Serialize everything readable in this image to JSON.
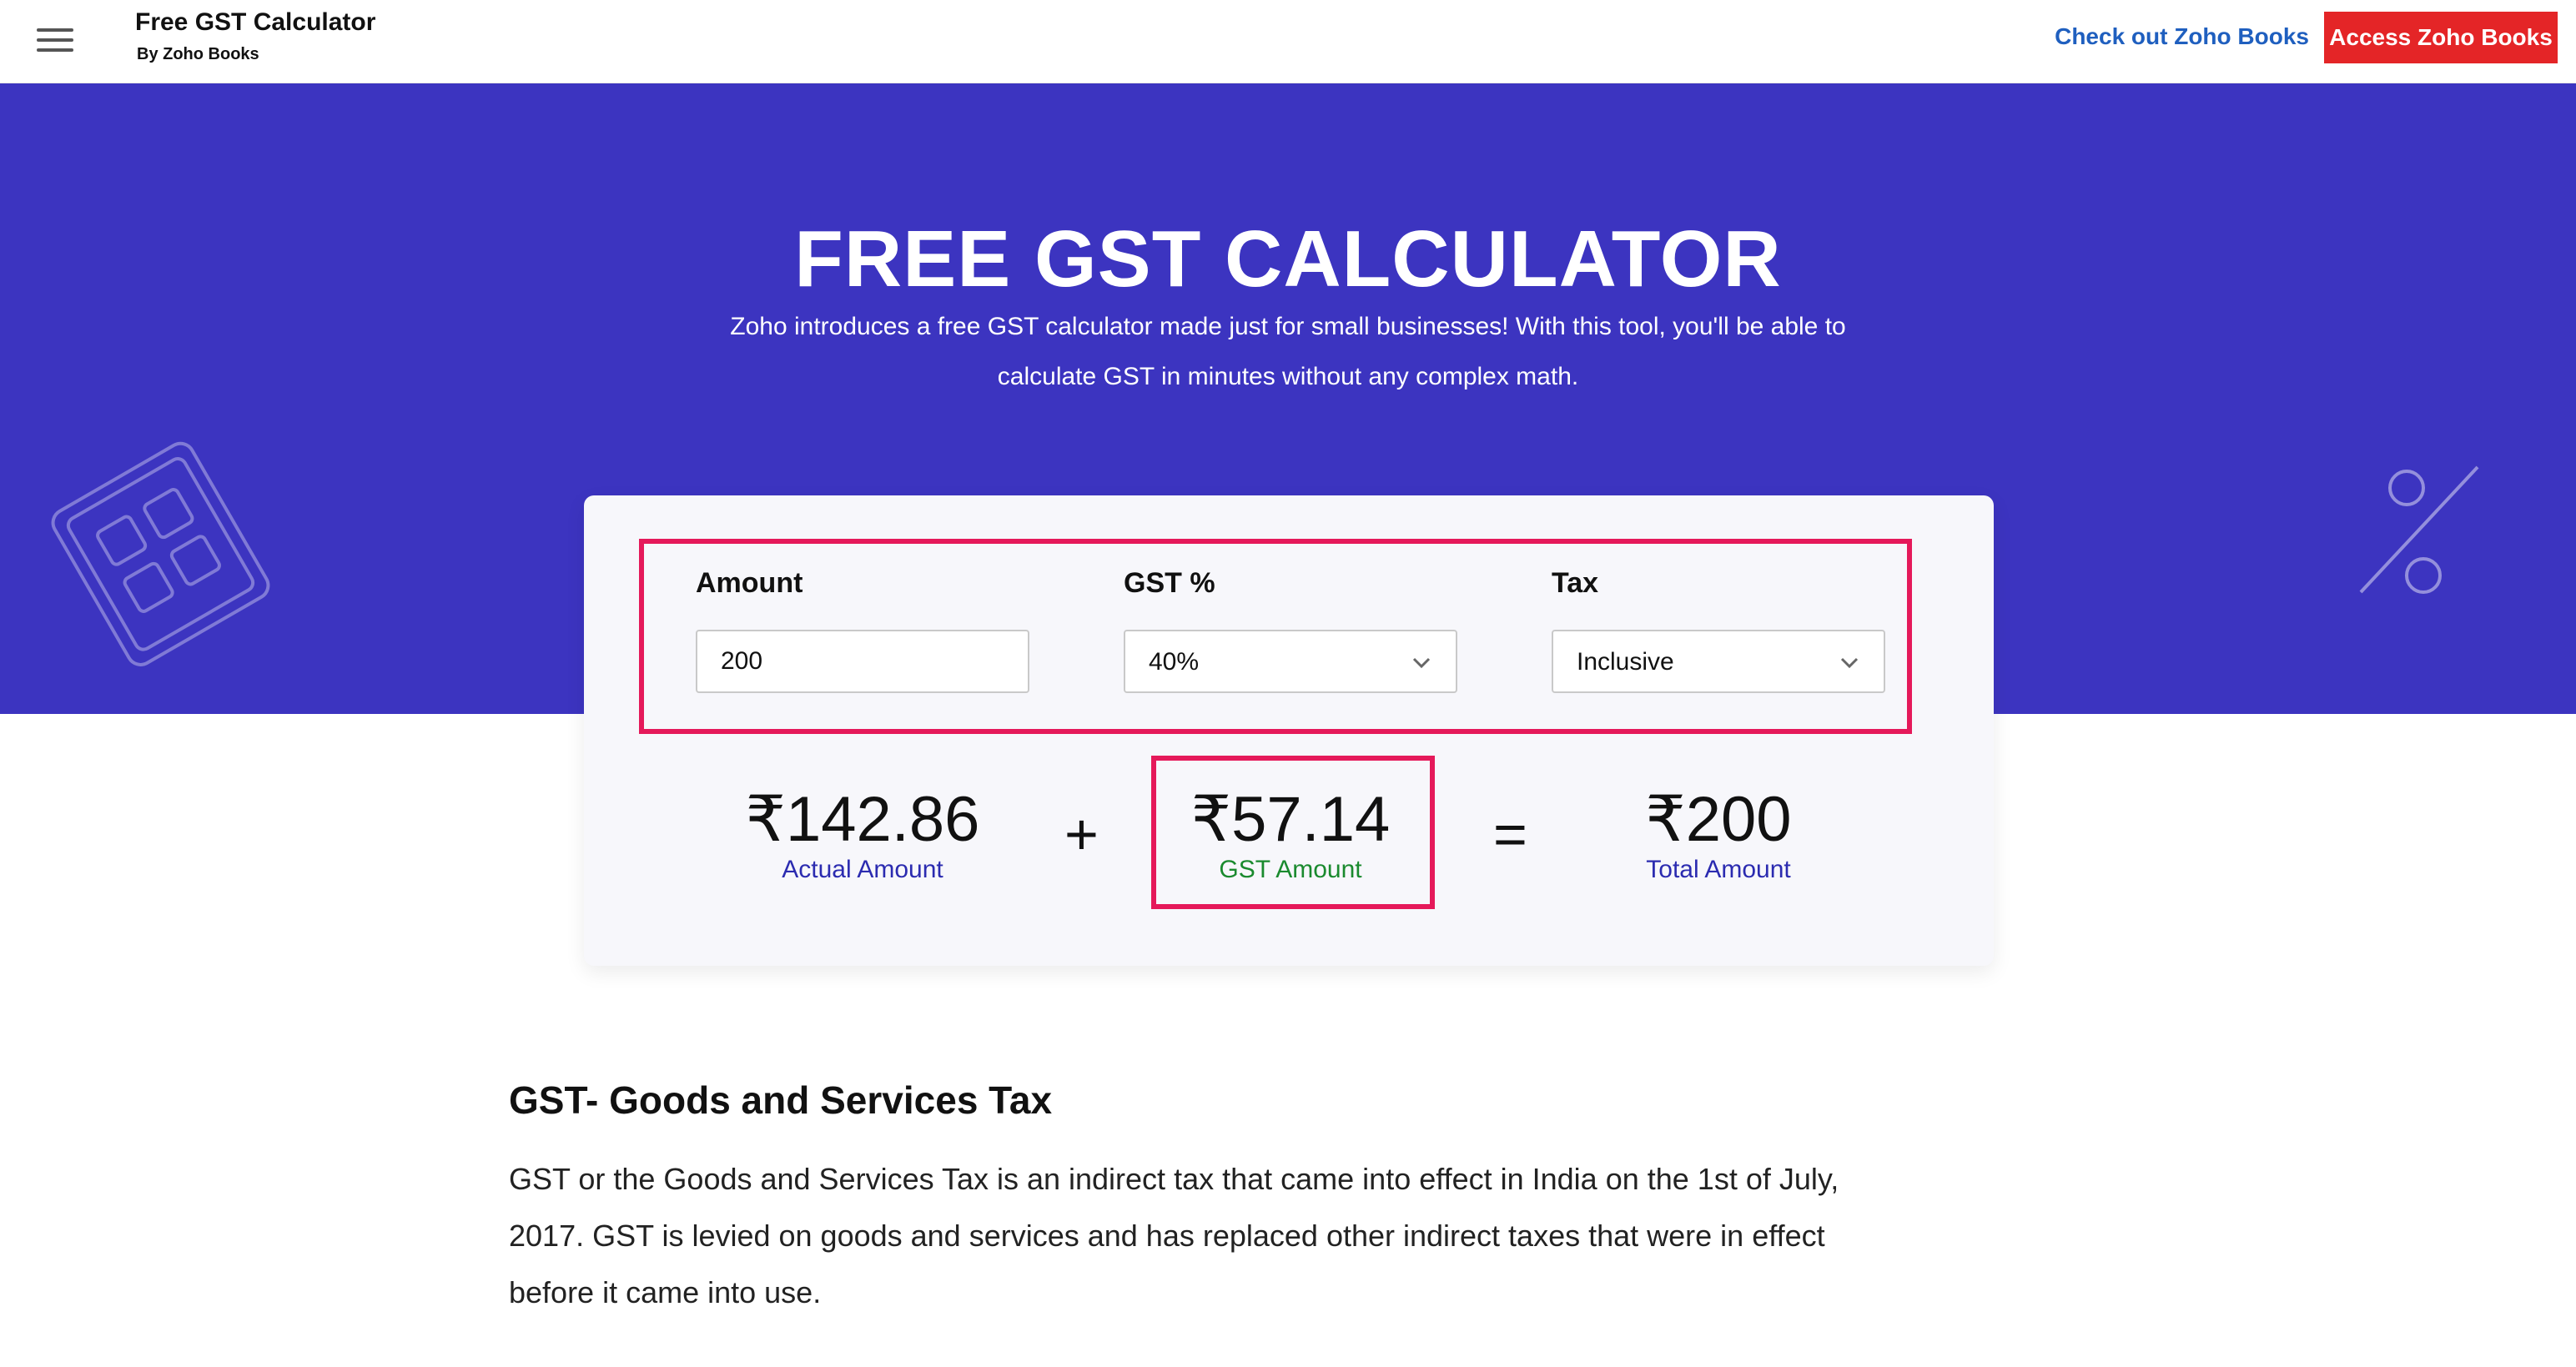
{
  "header": {
    "brand_title": "Free GST Calculator",
    "brand_subtitle": "By Zoho Books",
    "link_books": "Check out Zoho Books",
    "button_access": "Access Zoho Books",
    "menu_icon": "hamburger-menu-icon"
  },
  "hero": {
    "title": "FREE GST CALCULATOR",
    "description_line1": "Zoho introduces a free GST calculator made just for small businesses! With this tool, you'll be able to",
    "description_line2": "calculate GST in minutes without any complex math.",
    "decor_left_icon": "calculator-icon",
    "decor_right_icon": "percent-icon"
  },
  "calculator": {
    "amount_label": "Amount",
    "amount_value": "200",
    "gst_label": "GST %",
    "gst_value": "40%",
    "tax_label": "Tax",
    "tax_value": "Inclusive",
    "dropdown_icon": "chevron-down-icon"
  },
  "results": {
    "actual_value": "₹142.86",
    "actual_label": "Actual Amount",
    "plus": "+",
    "gst_value": "₹57.14",
    "gst_label": "GST Amount",
    "equals": "=",
    "total_value": "₹200",
    "total_label": "Total Amount"
  },
  "content": {
    "title": "GST- Goods and Services Tax",
    "body": "GST or the Goods and Services Tax is an indirect tax that came into effect in India on the 1st of July, 2017. GST is levied on goods and services and has replaced other indirect taxes that were in effect before it came into use."
  },
  "colors": {
    "hero_bg": "#3c34c0",
    "accent_red": "#e42527",
    "link_blue": "#1f5fbf",
    "highlight_pink": "#e5195a",
    "gst_green": "#1a8a2e"
  }
}
